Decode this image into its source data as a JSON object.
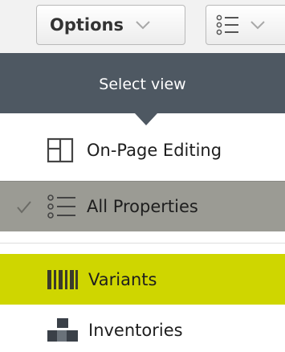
{
  "toolbar": {
    "options_label": "Options",
    "options_caret_icon": "chevron-down-icon",
    "view_icon": "list-view-icon",
    "view_caret_icon": "chevron-down-icon"
  },
  "view_menu": {
    "title": "Select view",
    "items": [
      {
        "label": "On-Page Editing",
        "icon": "layout-panels-icon",
        "selected": false,
        "highlighted": false
      },
      {
        "label": "All Properties",
        "icon": "list-view-icon",
        "selected": true,
        "highlighted": false
      },
      {
        "label": "Variants",
        "icon": "barcode-icon",
        "selected": false,
        "highlighted": true
      },
      {
        "label": "Inventories",
        "icon": "boxes-icon",
        "selected": false,
        "highlighted": false
      }
    ]
  },
  "colors": {
    "header_bg": "#4e5862",
    "selected_bg": "#9b9b94",
    "highlight_bg": "#cfd600"
  }
}
